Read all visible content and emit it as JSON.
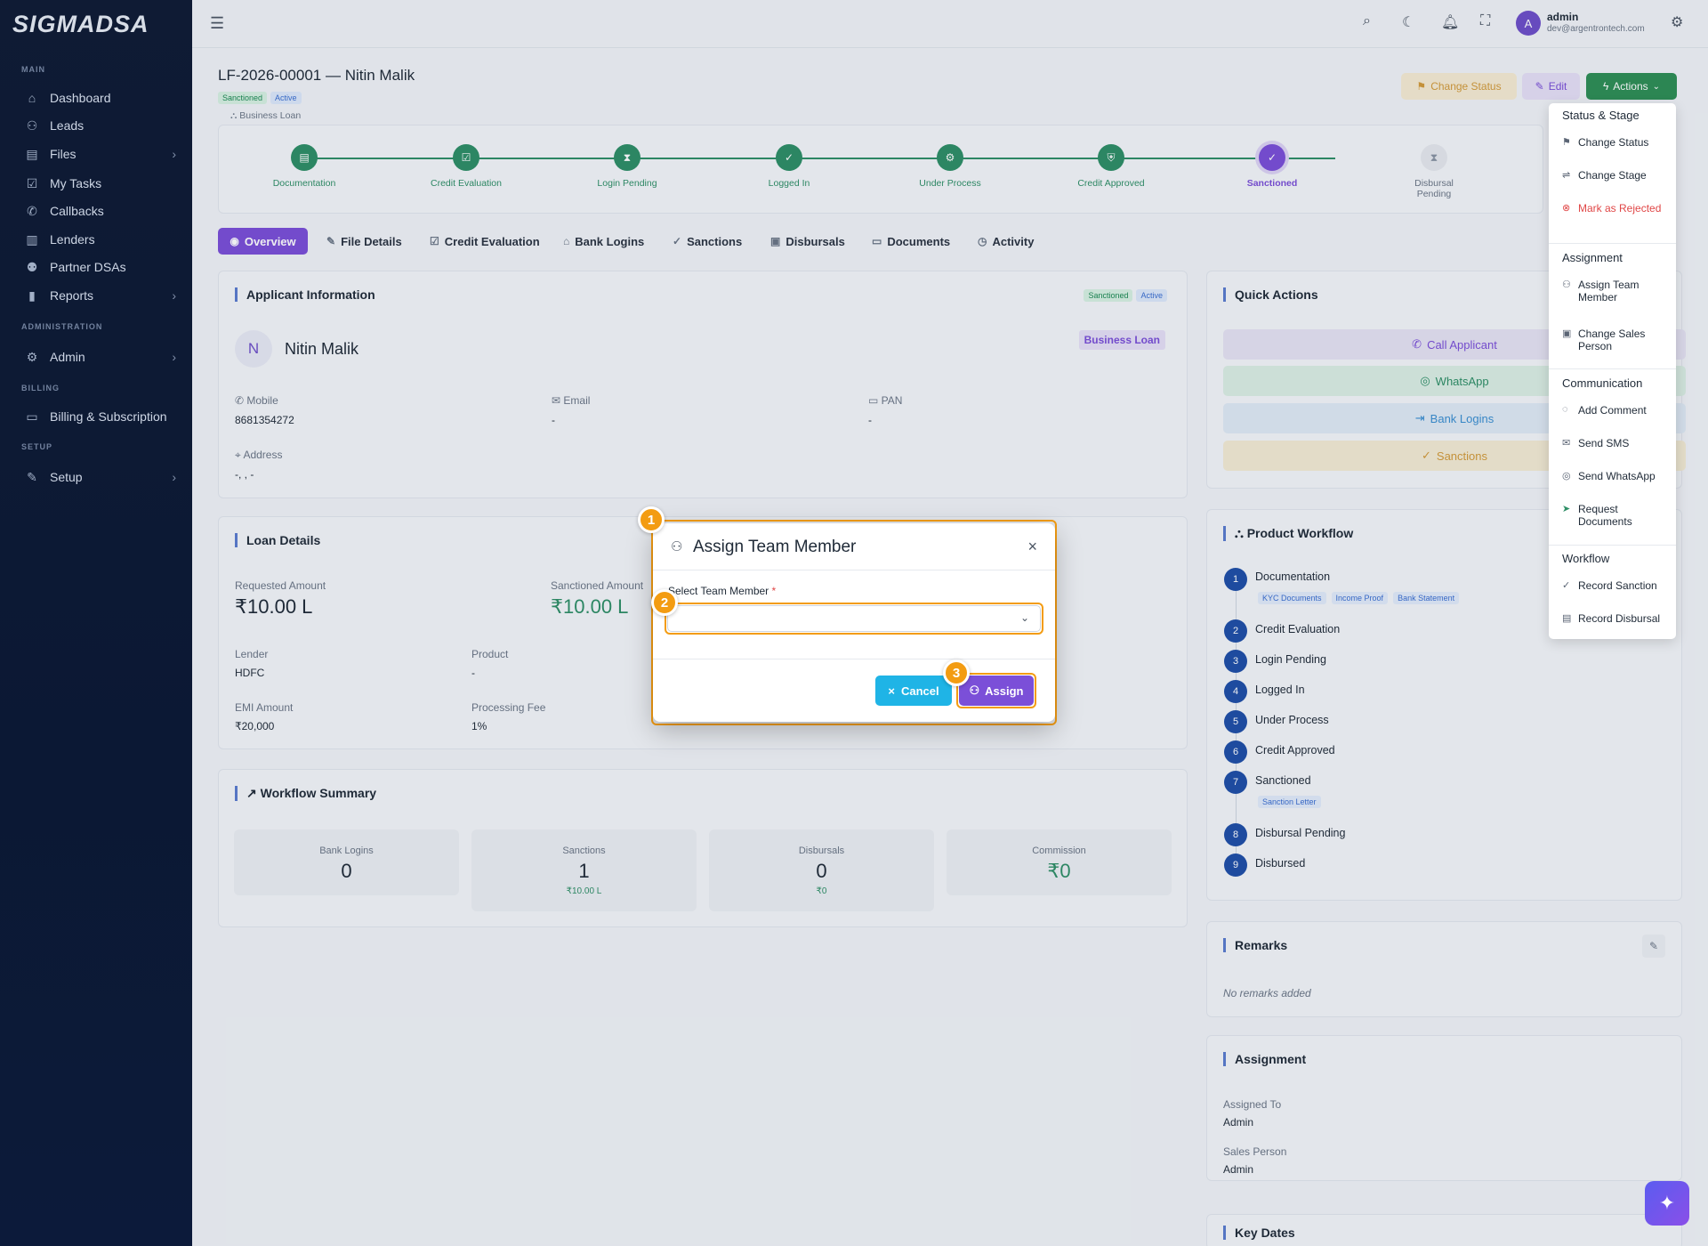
{
  "sidebar": {
    "logo": "SIGMADSA",
    "sections": {
      "main": "MAIN",
      "administration": "ADMINISTRATION",
      "billing": "BILLING",
      "setup": "SETUP"
    },
    "items": [
      {
        "label": "Dashboard",
        "icon": "home-icon"
      },
      {
        "label": "Leads",
        "icon": "user-plus-icon"
      },
      {
        "label": "Files",
        "icon": "file-icon"
      },
      {
        "label": "My Tasks",
        "icon": "clipboard-icon"
      },
      {
        "label": "Callbacks",
        "icon": "phone-icon"
      },
      {
        "label": "Lenders",
        "icon": "building-icon"
      },
      {
        "label": "Partner DSAs",
        "icon": "users-icon"
      },
      {
        "label": "Reports",
        "icon": "bar-chart-icon"
      },
      {
        "label": "Admin",
        "icon": "gear-icon"
      },
      {
        "label": "Billing & Subscription",
        "icon": "credit-card-icon"
      },
      {
        "label": "Setup",
        "icon": "wrench-icon"
      }
    ]
  },
  "topbar": {
    "user_initial": "A",
    "user_name": "admin",
    "user_email": "dev@argentrontech.com"
  },
  "header": {
    "title": "LF-2026-00001 — Nitin Malik",
    "badge_status": "Sanctioned",
    "badge_state": "Active",
    "loan_type": "Business Loan",
    "change_status_label": "Change Status",
    "edit_label": "Edit",
    "actions_label": "Actions"
  },
  "stages": [
    "Documentation",
    "Credit Evaluation",
    "Login Pending",
    "Logged In",
    "Under Process",
    "Credit Approved",
    "Sanctioned",
    "Disbursal Pending"
  ],
  "tabs": [
    "Overview",
    "File Details",
    "Credit Evaluation",
    "Bank Logins",
    "Sanctions",
    "Disbursals",
    "Documents",
    "Activity"
  ],
  "applicant": {
    "heading": "Applicant Information",
    "badge_status": "Sanctioned",
    "badge_state": "Active",
    "initial": "N",
    "name": "Nitin Malik",
    "loan_type": "Business Loan",
    "mobile_label": "Mobile",
    "mobile": "8681354272",
    "email_label": "Email",
    "email": "-",
    "pan_label": "PAN",
    "pan": "-",
    "address_label": "Address",
    "address": "-, , -"
  },
  "loan": {
    "heading": "Loan Details",
    "requested_label": "Requested Amount",
    "requested": "₹10.00 L",
    "sanctioned_label": "Sanctioned Amount",
    "sanctioned": "₹10.00 L",
    "lender_label": "Lender",
    "lender": "HDFC",
    "product_label": "Product",
    "product": "-",
    "emi_label": "EMI Amount",
    "emi": "₹20,000",
    "fee_label": "Processing Fee",
    "fee": "1%"
  },
  "workflow_summary": {
    "heading": "Workflow Summary",
    "stats": [
      {
        "title": "Bank Logins",
        "value": "0",
        "sub": ""
      },
      {
        "title": "Sanctions",
        "value": "1",
        "sub": "₹10.00 L"
      },
      {
        "title": "Disbursals",
        "value": "0",
        "sub": "₹0"
      },
      {
        "title": "Commission",
        "value": "₹0",
        "sub": ""
      }
    ]
  },
  "quick_actions": {
    "heading": "Quick Actions",
    "buttons": [
      "Call Applicant",
      "WhatsApp",
      "Bank Logins",
      "Sanctions"
    ]
  },
  "product_workflow": {
    "heading": "Product Workflow",
    "steps": [
      {
        "n": "1",
        "label": "Documentation",
        "chips": [
          "KYC Documents",
          "Income Proof",
          "Bank Statement"
        ]
      },
      {
        "n": "2",
        "label": "Credit Evaluation",
        "chips": []
      },
      {
        "n": "3",
        "label": "Login Pending",
        "chips": []
      },
      {
        "n": "4",
        "label": "Logged In",
        "chips": []
      },
      {
        "n": "5",
        "label": "Under Process",
        "chips": []
      },
      {
        "n": "6",
        "label": "Credit Approved",
        "chips": []
      },
      {
        "n": "7",
        "label": "Sanctioned",
        "chips": [
          "Sanction Letter"
        ]
      },
      {
        "n": "8",
        "label": "Disbursal Pending",
        "chips": []
      },
      {
        "n": "9",
        "label": "Disbursed",
        "chips": []
      }
    ]
  },
  "remarks": {
    "heading": "Remarks",
    "empty": "No remarks added"
  },
  "assignment": {
    "heading": "Assignment",
    "assigned_label": "Assigned To",
    "assigned": "Admin",
    "sales_label": "Sales Person",
    "sales": "Admin"
  },
  "key_dates": {
    "heading": "Key Dates"
  },
  "actions_menu": {
    "group1": "Status & Stage",
    "change_status": "Change Status",
    "change_stage": "Change Stage",
    "mark_rejected": "Mark as Rejected",
    "group2": "Assignment",
    "assign_team": "Assign Team Member",
    "change_sales": "Change Sales Person",
    "group3": "Communication",
    "add_comment": "Add Comment",
    "send_sms": "Send SMS",
    "send_whatsapp": "Send WhatsApp",
    "request_docs": "Request Documents",
    "group4": "Workflow",
    "record_sanction": "Record Sanction",
    "record_disbursal": "Record Disbursal"
  },
  "modal": {
    "title": "Assign Team Member",
    "field_label": "Select Team Member",
    "required_mark": "*",
    "cancel_label": "Cancel",
    "assign_label": "Assign"
  },
  "markers": [
    "1",
    "2",
    "3"
  ],
  "colors": {
    "accent": "#7b4fd8",
    "success": "#2e8f66",
    "highlight": "#f39c12",
    "cancel": "#1fb4e6",
    "sidebar": "#0f1b34"
  }
}
